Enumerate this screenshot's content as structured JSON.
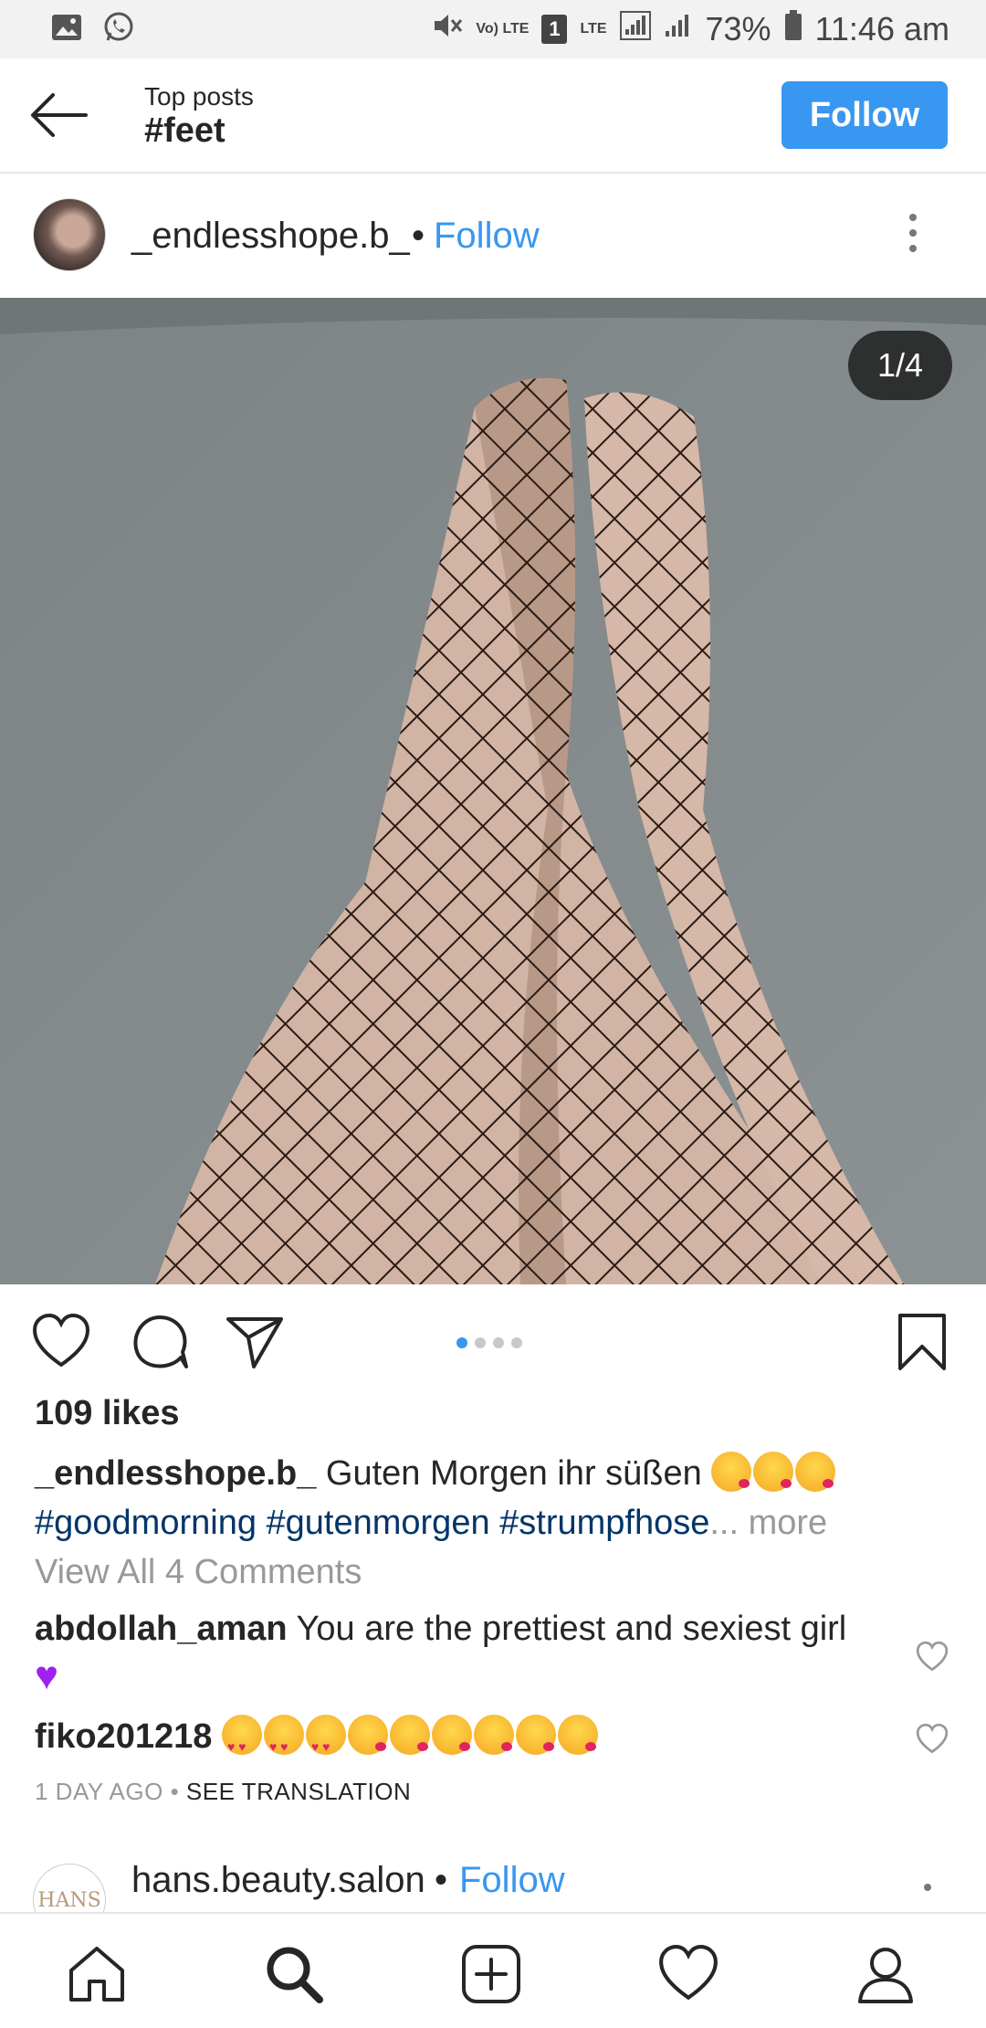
{
  "status_bar": {
    "left_icons": [
      "gallery-icon",
      "whatsapp-icon"
    ],
    "right_icons": [
      "mute-icon",
      "volte-icon",
      "sim-icon",
      "lte-signal-icon",
      "signal-icon",
      "battery-icon"
    ],
    "volte": "Vo) LTE",
    "sim": "1",
    "lte": "LTE",
    "battery": "73%",
    "time": "11:46 am"
  },
  "header": {
    "subtitle": "Top posts",
    "title": "#feet",
    "follow_label": "Follow"
  },
  "post": {
    "username": "_endlesshope.b_",
    "dot": "•",
    "follow_label": "Follow",
    "image_counter": "1/4",
    "carousel": {
      "count": 4,
      "active": 1
    },
    "likes": "109 likes",
    "caption_user": "_endlesshope.b_",
    "caption_text": "Guten Morgen ihr süßen",
    "hashtags": "#goodmorning #gutenmorgen #strumpfhose",
    "more": "... more",
    "view_all": "View All 4 Comments",
    "comments": [
      {
        "user": "abdollah_aman",
        "text": "You are the prettiest and sexiest girl"
      },
      {
        "user": "fiko201218",
        "text": ""
      }
    ],
    "time_ago": "1 DAY AGO",
    "separator": "•",
    "see_translation": "SEE TRANSLATION"
  },
  "next_post": {
    "username": "hans.beauty.salon",
    "dot": "•",
    "follow_label": "Follow",
    "avatar_text": "HANS"
  },
  "bottom_nav": [
    "home-icon",
    "search-icon",
    "add-icon",
    "heart-icon",
    "profile-icon"
  ],
  "colors": {
    "accent": "#3897f0",
    "hashtag": "#003569",
    "muted": "#999999"
  }
}
